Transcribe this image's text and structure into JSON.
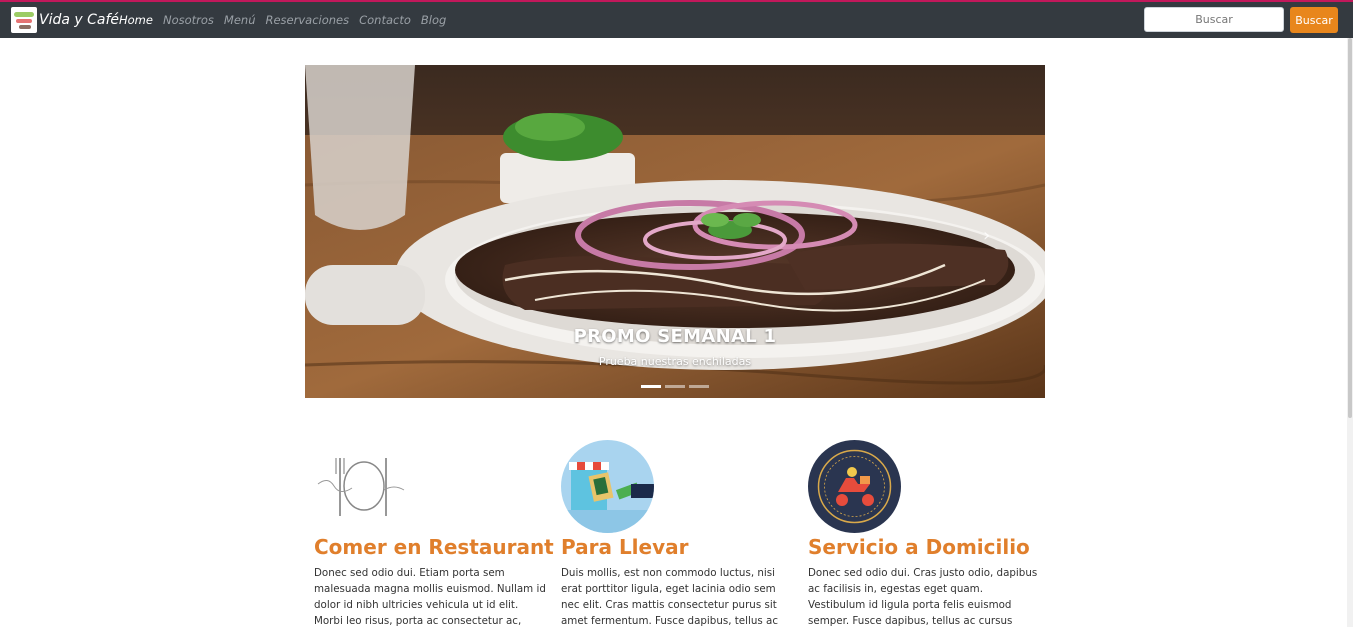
{
  "brand": {
    "name": "Vida y Café"
  },
  "nav": {
    "items": [
      {
        "label": "Home"
      },
      {
        "label": "Nosotros"
      },
      {
        "label": "Menú"
      },
      {
        "label": "Reservaciones"
      },
      {
        "label": "Contacto"
      },
      {
        "label": "Blog"
      }
    ]
  },
  "search": {
    "placeholder": "Buscar",
    "button_label": "Buscar"
  },
  "carousel": {
    "slide_title": "PROMO SEMANAL 1",
    "slide_caption": "Prueba nuestras enchiladas",
    "slide_count": 3,
    "active_slide": 1,
    "next_icon": "chevron-right-icon"
  },
  "services": [
    {
      "icon": "restaurant-sketch-icon",
      "title": "Comer en Restaurant",
      "text": "Donec sed odio dui. Etiam porta sem malesuada magna mollis euismod. Nullam id dolor id nibh ultricies vehicula ut id elit. Morbi leo risus, porta ac consectetur ac, vestibulum at"
    },
    {
      "icon": "storefront-icon",
      "title": "Para Llevar",
      "text": "Duis mollis, est non commodo luctus, nisi erat porttitor ligula, eget lacinia odio sem nec elit. Cras mattis consectetur purus sit amet fermentum. Fusce dapibus, tellus ac cursus"
    },
    {
      "icon": "delivery-scooter-icon",
      "title": "Servicio a Domicilio",
      "text": "Donec sed odio dui. Cras justo odio, dapibus ac facilisis in, egestas eget quam. Vestibulum id ligula porta felis euismod semper. Fusce dapibus, tellus ac cursus commodo, tortor"
    }
  ],
  "colors": {
    "navbar": "#343a40",
    "accent": "#e8861c",
    "heading": "#e07f2c",
    "top_accent": "#c2185b"
  }
}
